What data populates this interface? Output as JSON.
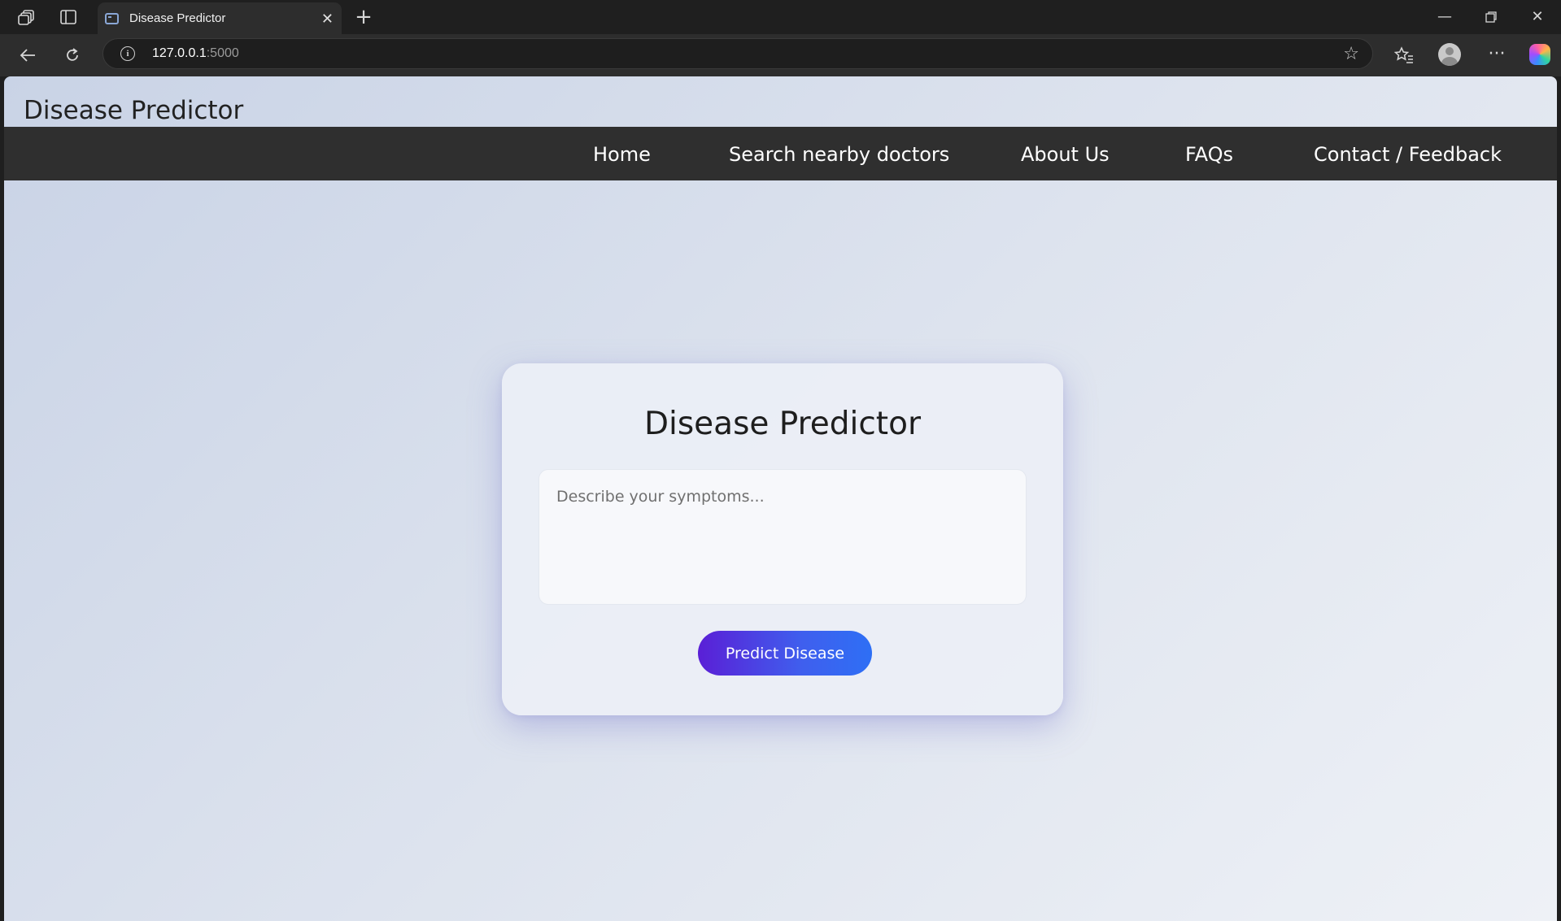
{
  "browser": {
    "tab_title": "Disease Predictor",
    "url_host": "127.0.0.1",
    "url_port": ":5000",
    "icons": {
      "workspaces": "workspaces-icon",
      "tab_actions": "tab-actions-icon",
      "new_tab": "plus-icon",
      "back": "back-arrow-icon",
      "refresh": "refresh-icon",
      "site_info": "info-icon",
      "favorite": "star-icon",
      "favorites": "favorites-icon",
      "profile": "profile-icon",
      "more": "more-icon",
      "copilot": "copilot-icon"
    }
  },
  "header": {
    "brand": "Disease Predictor"
  },
  "nav": {
    "items": [
      {
        "label": "Home"
      },
      {
        "label": "Search nearby doctors"
      },
      {
        "label": "About Us"
      },
      {
        "label": "FAQs"
      },
      {
        "label": "Contact / Feedback"
      }
    ]
  },
  "card": {
    "title": "Disease Predictor",
    "symptoms_placeholder": "Describe your symptoms...",
    "symptoms_value": "",
    "predict_label": "Predict Disease"
  },
  "colors": {
    "navbar": "#2f2f2f",
    "button_start": "#5a1fd6",
    "button_end": "#2e6ff5"
  }
}
